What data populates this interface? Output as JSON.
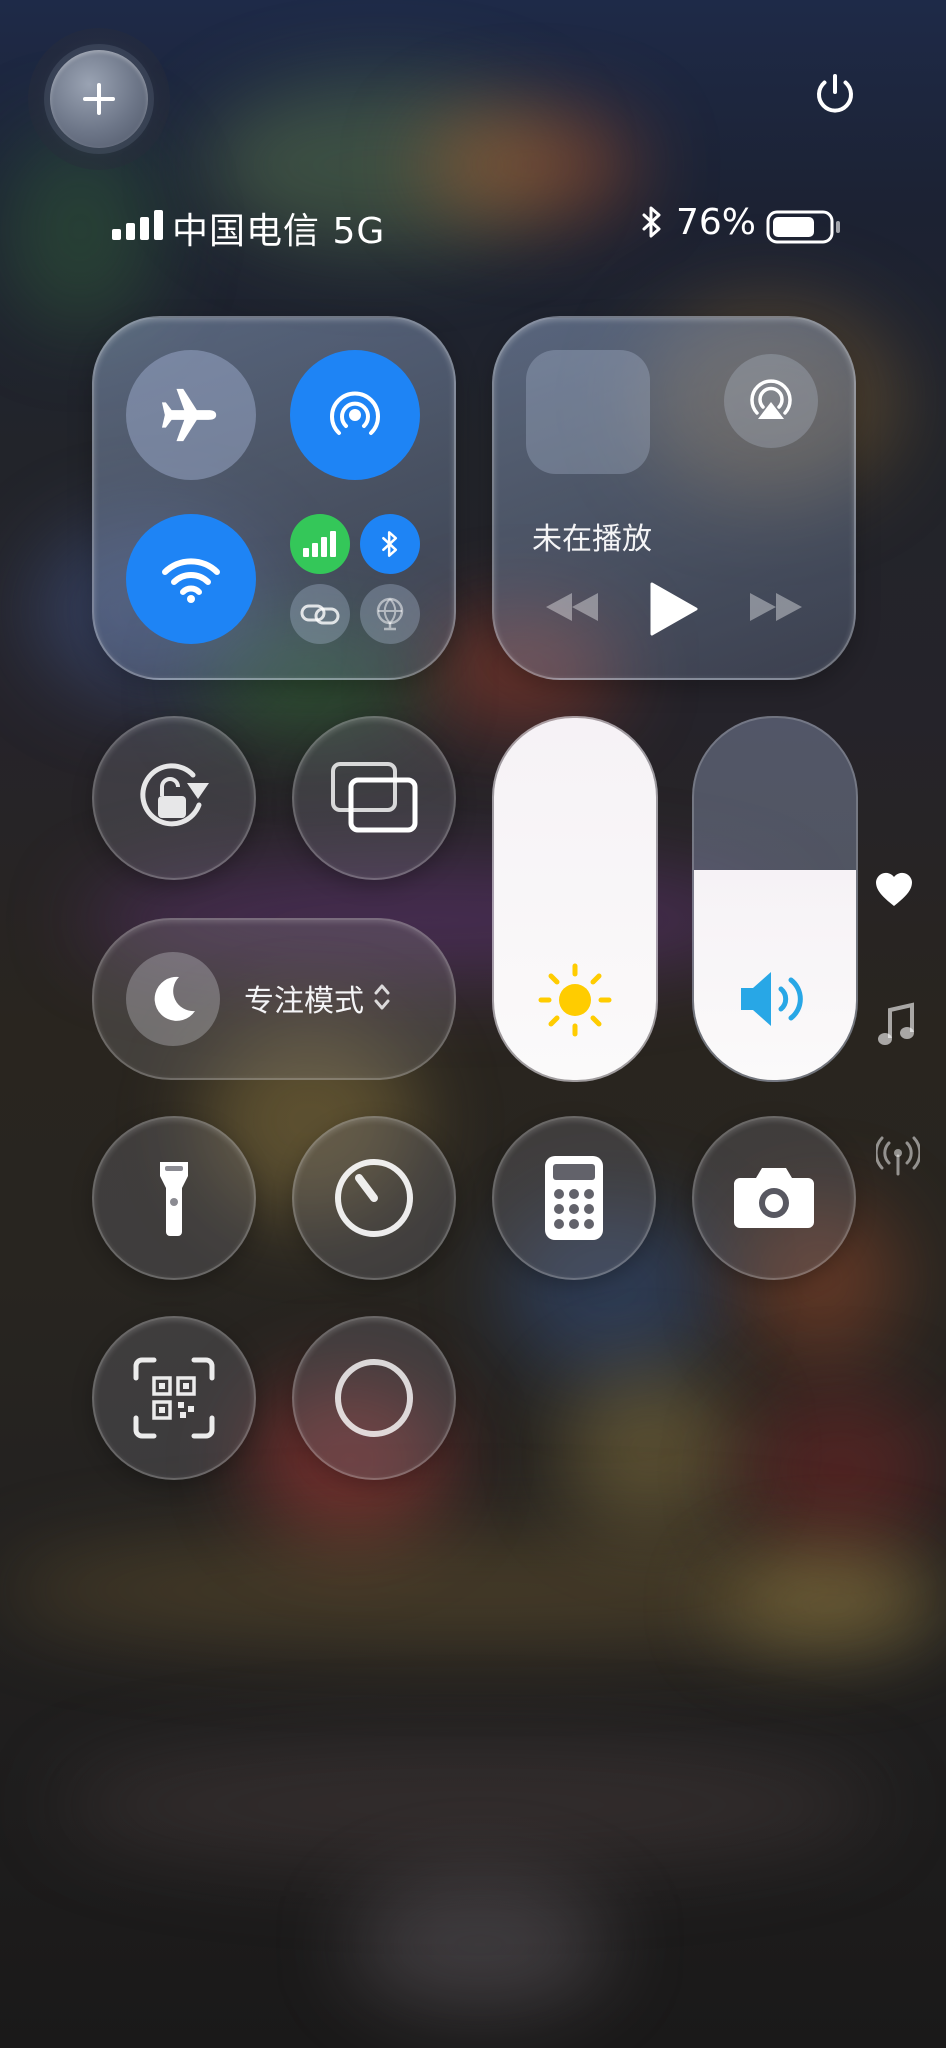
{
  "status_bar": {
    "carrier": "中国电信 5G",
    "battery_percent": "76%",
    "battery_level": 0.76,
    "signal_bars": 4
  },
  "connectivity": {
    "airplane_mode": "off",
    "personal_hotspot": "on",
    "wifi": "on",
    "cellular": "on",
    "bluetooth": "on",
    "link": "off",
    "vpn": "off"
  },
  "media": {
    "status_text": "未在播放",
    "controls": [
      "backward-icon",
      "play-icon",
      "forward-icon"
    ]
  },
  "brightness_level": 1.0,
  "volume_level": 0.58,
  "focus": {
    "label": "专注模式"
  },
  "controls": [
    "rotation-lock-icon",
    "screen-mirroring-icon",
    "flashlight-icon",
    "timer-icon",
    "calculator-icon",
    "camera-icon",
    "qr-scanner-icon",
    "screen-record-icon"
  ],
  "side_icons": [
    "heart-icon",
    "music-note-icon",
    "antenna-icon"
  ],
  "colors": {
    "accent_blue": "#1e84f5",
    "cellular_green": "#34c759",
    "brightness_yellow": "#ffcc00",
    "volume_blue": "#28a7e6"
  }
}
